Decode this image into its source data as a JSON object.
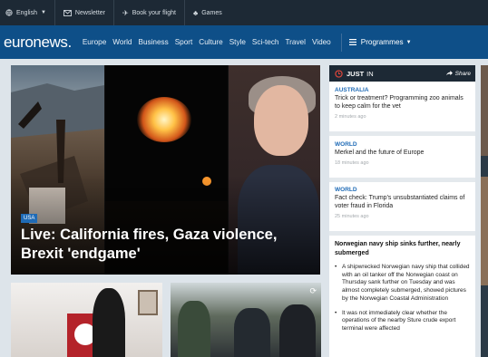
{
  "topbar": {
    "language": "English",
    "newsletter": "Newsletter",
    "book_flight": "Book your flight",
    "games": "Games"
  },
  "nav": {
    "logo": "euronews.",
    "links": [
      "Europe",
      "World",
      "Business",
      "Sport",
      "Culture",
      "Style",
      "Sci-tech",
      "Travel",
      "Video"
    ],
    "programmes": "Programmes"
  },
  "hero": {
    "tag": "USA",
    "title": "Live: California fires, Gaza violence, Brexit 'endgame'"
  },
  "just_in": {
    "label_just": "JUST",
    "label_in": "IN",
    "share": "Share",
    "items": [
      {
        "region": "AUSTRALIA",
        "text": "Trick or treatment? Programming zoo animals to keep calm for the vet",
        "time": "2 minutes ago"
      },
      {
        "region": "WORLD",
        "text": "Merkel and the future of Europe",
        "time": "18 minutes ago"
      },
      {
        "region": "WORLD",
        "text": "Fact check: Trump's unsubstantiated claims of voter fraud in Florida",
        "time": "25 minutes ago"
      }
    ],
    "story": {
      "title": "Norwegian navy ship sinks further, nearly submerged",
      "bullets": [
        "A shipwrecked Norwegian navy ship that collided with an oil tanker off the Norwegian coast on Thursday sank further on Tuesday and was almost completely submerged, showed pictures by the Norwegian Coastal Administration",
        "It was not immediately clear whether the operations of the nearby Sture crude export terminal were affected"
      ]
    }
  },
  "colors": {
    "nav_blue": "#0e4f88",
    "topbar_dark": "#1d2935",
    "region_blue": "#1f6bb6",
    "clock_red": "#e0453a"
  }
}
